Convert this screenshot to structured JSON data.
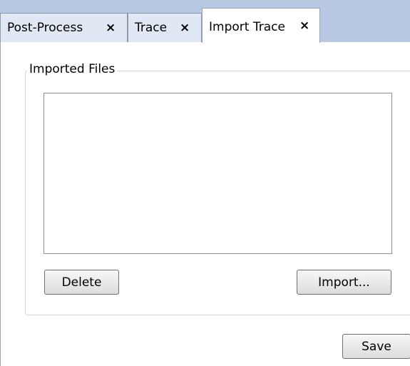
{
  "tabs": [
    {
      "label": "Post-Process",
      "close": "×"
    },
    {
      "label": "Trace",
      "close": "×"
    },
    {
      "label": "Import Trace",
      "close": "×"
    }
  ],
  "group": {
    "title": "Imported Files",
    "files": []
  },
  "buttons": {
    "delete": "Delete",
    "import": "Import...",
    "save": "Save"
  },
  "colors": {
    "tabstrip_bg": "#b7c9e2",
    "inactive_tab_bg": "#dfe8f3",
    "active_tab_bg": "#ffffff"
  }
}
